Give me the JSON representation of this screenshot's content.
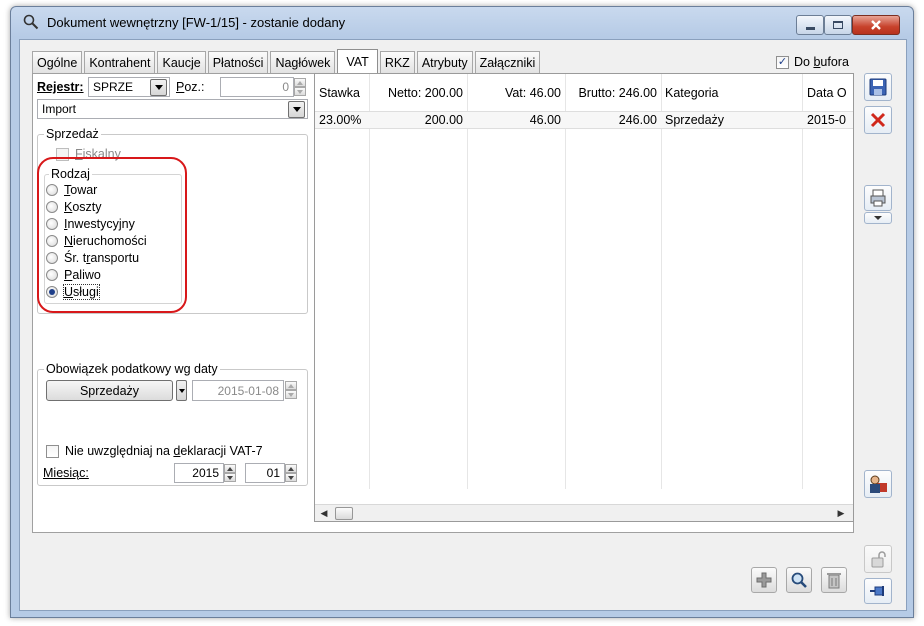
{
  "window": {
    "title": "Dokument wewnętrzny [FW-1/15]  - zostanie dodany"
  },
  "tabs": [
    {
      "label": "Ogólne"
    },
    {
      "label": "Kontrahent"
    },
    {
      "label": "Kaucje"
    },
    {
      "label": "Płatności"
    },
    {
      "label": "Nagłówek"
    },
    {
      "label": "VAT"
    },
    {
      "label": "RKZ"
    },
    {
      "label": "Atrybuty"
    },
    {
      "label": "Załączniki"
    }
  ],
  "do_bufora": {
    "label_pre": "Do ",
    "label_u": "b",
    "label_post": "ufora",
    "checked": "✓"
  },
  "rejestr": {
    "label": "Rejestr:",
    "value": "SPRZE"
  },
  "poz": {
    "label_u": "P",
    "label_post": "oz.:",
    "value": "0"
  },
  "import": {
    "value": "Import"
  },
  "sprzedaz": {
    "group_label": "Sprzedaż",
    "fiskalny_u": "F",
    "fiskalny_post": "iskalny"
  },
  "rodzaj": {
    "group_label": "Rodzaj",
    "options": [
      {
        "u": "T",
        "post": "owar"
      },
      {
        "u": "K",
        "post": "oszty"
      },
      {
        "u": "I",
        "post": "nwestycyjny"
      },
      {
        "u": "N",
        "post": "ieruchomości"
      },
      {
        "pre": "Śr. t",
        "u": "r",
        "post": "ansportu"
      },
      {
        "u": "P",
        "post": "aliwo"
      },
      {
        "u": "U",
        "post": "sługi"
      }
    ],
    "selected": "Usługi"
  },
  "obowiazek": {
    "group_label": "Obowiązek podatkowy wg daty",
    "button_label": "Sprzedaży",
    "date": "2015-01-08"
  },
  "vat7": {
    "pre": "Nie uwzględniaj na ",
    "u": "d",
    "post": "eklaracji VAT-7"
  },
  "miesiac": {
    "label": "Miesiąc:",
    "year": "2015",
    "month": "01"
  },
  "grid": {
    "headers": [
      "Stawka",
      "Netto: 200.00",
      "Vat: 46.00",
      "Brutto: 246.00",
      "Kategoria",
      "Data O"
    ],
    "rows": [
      [
        "23.00%",
        "200.00",
        "46.00",
        "246.00",
        "Sprzedaży",
        "2015-0"
      ]
    ]
  },
  "colors": {
    "highlight": "#d8181a",
    "accent": "#1f3f8a"
  }
}
